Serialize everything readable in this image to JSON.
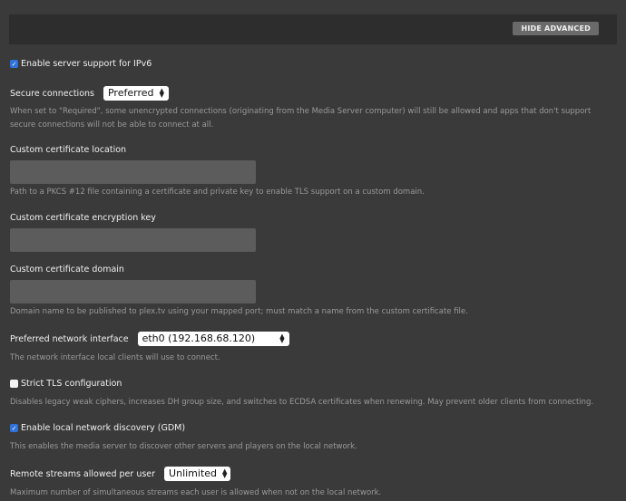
{
  "header": {
    "hide_advanced_label": "HIDE ADVANCED"
  },
  "ipv6": {
    "label": "Enable server support for IPv6",
    "checked": true
  },
  "secure_connections": {
    "label": "Secure connections",
    "value": "Preferred",
    "description": "When set to \"Required\", some unencrypted connections (originating from the Media Server computer) will still be allowed and apps that don't support secure connections will not be able to connect at all."
  },
  "cert_location": {
    "label": "Custom certificate location",
    "value": "",
    "description": "Path to a PKCS #12 file containing a certificate and private key to enable TLS support on a custom domain."
  },
  "cert_key": {
    "label": "Custom certificate encryption key",
    "value": ""
  },
  "cert_domain": {
    "label": "Custom certificate domain",
    "value": "",
    "description": "Domain name to be published to plex.tv using your mapped port; must match a name from the custom certificate file."
  },
  "network_interface": {
    "label": "Preferred network interface",
    "value": "eth0 (192.168.68.120)",
    "description": "The network interface local clients will use to connect."
  },
  "strict_tls": {
    "label": "Strict TLS configuration",
    "checked": false,
    "description": "Disables legacy weak ciphers, increases DH group size, and switches to ECDSA certificates when renewing. May prevent older clients from connecting."
  },
  "gdm": {
    "label": "Enable local network discovery (GDM)",
    "checked": true,
    "description": "This enables the media server to discover other servers and players on the local network."
  },
  "remote_streams": {
    "label": "Remote streams allowed per user",
    "value": "Unlimited",
    "description": "Maximum number of simultaneous streams each user is allowed when not on the local network."
  }
}
